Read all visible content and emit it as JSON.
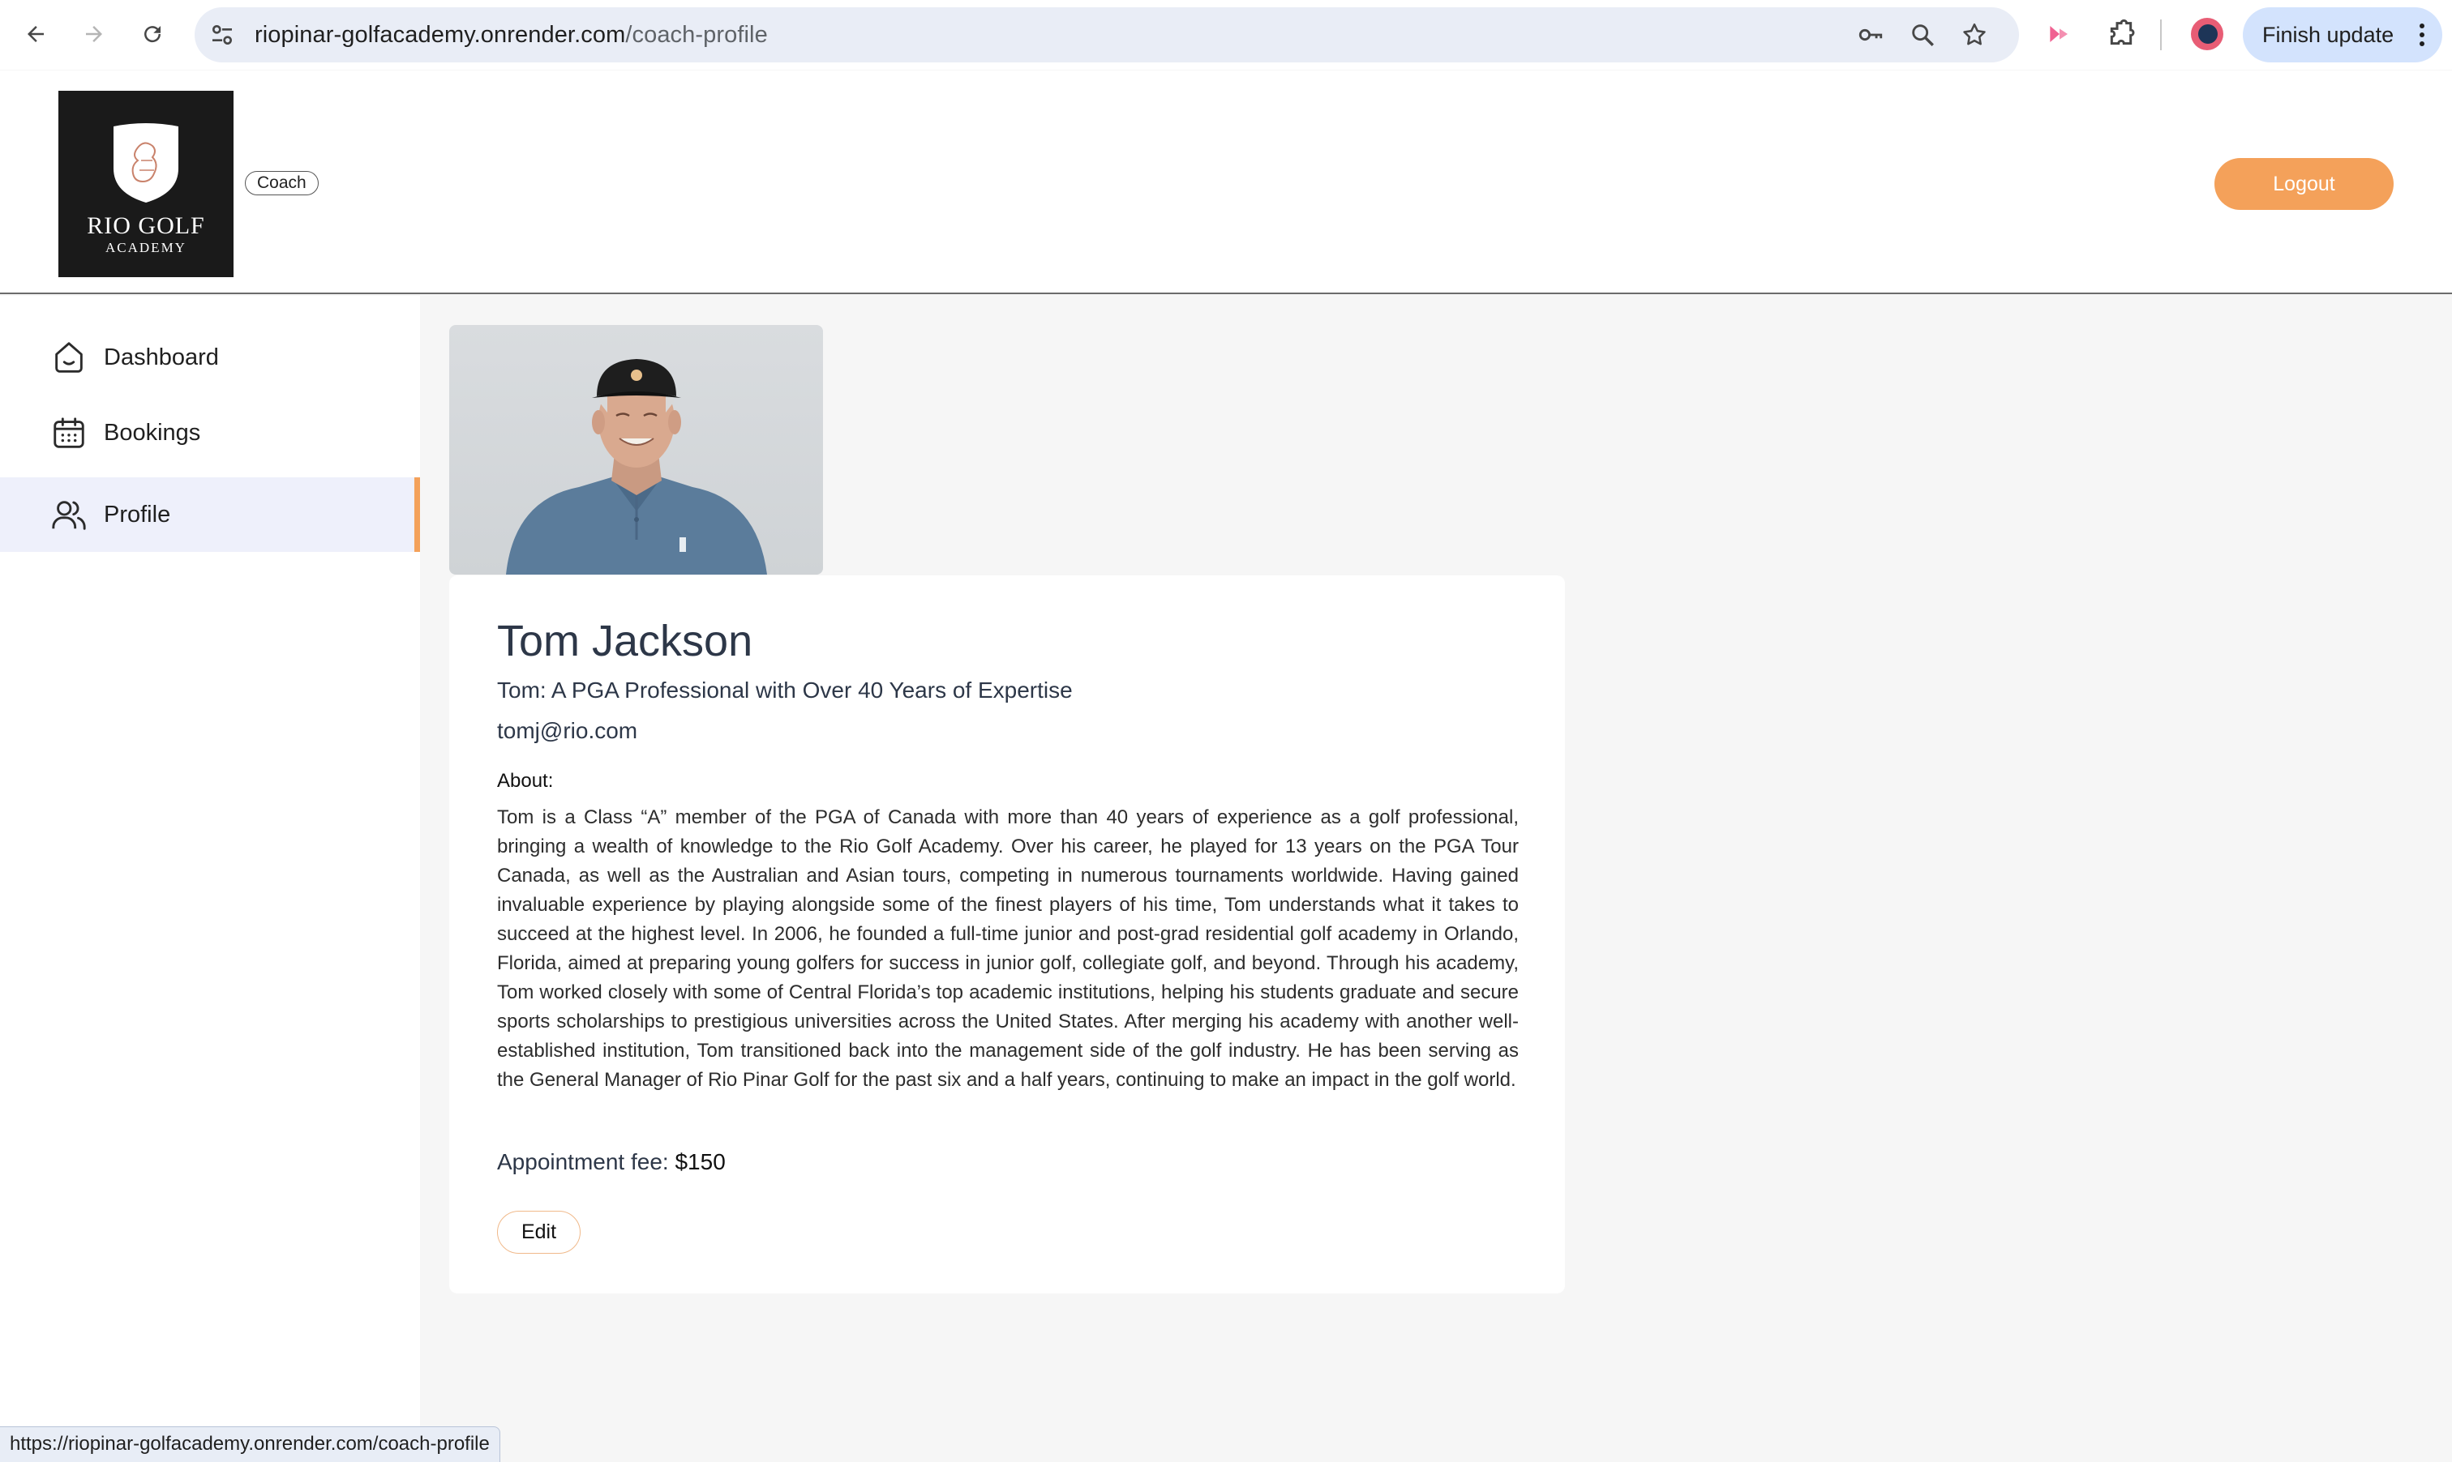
{
  "browser": {
    "url_host": "riopinar-golfacademy.onrender.com",
    "url_path": "/coach-profile",
    "finish_update_label": "Finish update"
  },
  "header": {
    "logo_title": "RIO GOLF",
    "logo_subtitle": "ACADEMY",
    "role_badge": "Coach",
    "logout_label": "Logout"
  },
  "sidebar": {
    "items": [
      {
        "label": "Dashboard",
        "icon": "home-icon",
        "active": false
      },
      {
        "label": "Bookings",
        "icon": "calendar-icon",
        "active": false
      },
      {
        "label": "Profile",
        "icon": "users-icon",
        "active": true
      }
    ]
  },
  "profile": {
    "name": "Tom Jackson",
    "headline": "Tom: A PGA Professional with Over 40 Years of Expertise",
    "email": "tomj@rio.com",
    "about_label": "About:",
    "about_text": "Tom is a Class “A” member of the PGA of Canada with more than 40 years of experience as a golf professional, bringing a wealth of knowledge to the Rio Golf Academy. Over his career, he played for 13 years on the PGA Tour Canada, as well as the Australian and Asian tours, competing in numerous tournaments worldwide. Having gained invaluable experience by playing alongside some of the finest players of his time, Tom understands what it takes to succeed at the highest level. In 2006, he founded a full-time junior and post-grad residential golf academy in Orlando, Florida, aimed at preparing young golfers for success in junior golf, collegiate golf, and beyond. Through his academy, Tom worked closely with some of Central Florida’s top academic institutions, helping his students graduate and secure sports scholarships to prestigious universities across the United States. After merging his academy with another well-established institution, Tom transitioned back into the management side of the golf industry. He has been serving as the General Manager of Rio Pinar Golf for the past six and a half years, continuing to make an impact in the golf world.",
    "fee_label": "Appointment fee: ",
    "fee_value": "$150",
    "edit_label": "Edit"
  },
  "status_bar": {
    "link_preview": "https://riopinar-golfacademy.onrender.com/coach-profile"
  },
  "colors": {
    "accent": "#f4a15a",
    "active_nav_bg": "#eef0fb",
    "heading": "#2d3748"
  }
}
